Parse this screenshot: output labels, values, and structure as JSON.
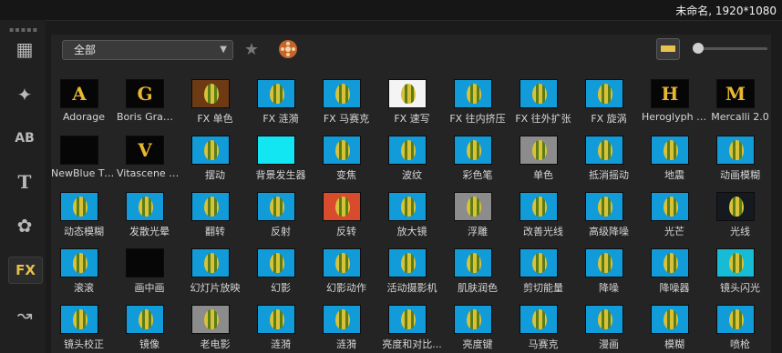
{
  "window": {
    "project_info": "未命名, 1920*1080"
  },
  "sidebar": {
    "icons": [
      "media-icon",
      "instant-project-icon",
      "title-ab-icon",
      "text-t-icon",
      "graphics-icon",
      "fx-icon",
      "path-icon"
    ],
    "fx_label": "FX",
    "ab_label": "AB"
  },
  "toolbar": {
    "category_selected": "全部",
    "dropdown_arrow": "▼"
  },
  "grid": {
    "items": [
      {
        "label": "Adorage",
        "style": "letter",
        "letter": "A"
      },
      {
        "label": "Boris Graffiti ...",
        "style": "letter",
        "letter": "G"
      },
      {
        "label": "FX 单色",
        "style": "brown"
      },
      {
        "label": "FX 涟漪",
        "style": "blue"
      },
      {
        "label": "FX 马赛克",
        "style": "blue"
      },
      {
        "label": "FX 速写",
        "style": "white"
      },
      {
        "label": "FX 往内挤压",
        "style": "blue"
      },
      {
        "label": "FX 往外扩张",
        "style": "blue"
      },
      {
        "label": "FX 旋涡",
        "style": "blue"
      },
      {
        "label": "Heroglyph Ti...",
        "style": "letter",
        "letter": "H"
      },
      {
        "label": "Mercalli 2.0",
        "style": "letter",
        "letter": "M"
      },
      {
        "label": "NewBlue Titl...",
        "style": "black"
      },
      {
        "label": "Vitascene 2.0",
        "style": "letter",
        "letter": "V"
      },
      {
        "label": "摆动",
        "style": "blue"
      },
      {
        "label": "背景发生器",
        "style": "cyan"
      },
      {
        "label": "变焦",
        "style": "blue"
      },
      {
        "label": "波纹",
        "style": "blue"
      },
      {
        "label": "彩色笔",
        "style": "blue"
      },
      {
        "label": "单色",
        "style": "gray"
      },
      {
        "label": "抵消摇动",
        "style": "blue"
      },
      {
        "label": "地震",
        "style": "blue"
      },
      {
        "label": "动画模糊",
        "style": "blue"
      },
      {
        "label": "动态模糊",
        "style": "blue"
      },
      {
        "label": "发散光晕",
        "style": "blue"
      },
      {
        "label": "翻转",
        "style": "blue"
      },
      {
        "label": "反射",
        "style": "blue"
      },
      {
        "label": "反转",
        "style": "red"
      },
      {
        "label": "放大镜",
        "style": "blue"
      },
      {
        "label": "浮雕",
        "style": "gray"
      },
      {
        "label": "改善光线",
        "style": "blue"
      },
      {
        "label": "高级降噪",
        "style": "blue"
      },
      {
        "label": "光芒",
        "style": "blue"
      },
      {
        "label": "光线",
        "style": "dark"
      },
      {
        "label": "滚滚",
        "style": "blue"
      },
      {
        "label": "画中画",
        "style": "black"
      },
      {
        "label": "幻灯片放映",
        "style": "blue"
      },
      {
        "label": "幻影",
        "style": "blue"
      },
      {
        "label": "幻影动作",
        "style": "blue"
      },
      {
        "label": "活动摄影机",
        "style": "blue"
      },
      {
        "label": "肌肤润色",
        "style": "blue"
      },
      {
        "label": "剪切能量",
        "style": "blue"
      },
      {
        "label": "降噪",
        "style": "blue"
      },
      {
        "label": "降噪器",
        "style": "blue"
      },
      {
        "label": "镜头闪光",
        "style": "aqua"
      },
      {
        "label": "镜头校正",
        "style": "blue"
      },
      {
        "label": "镜像",
        "style": "blue"
      },
      {
        "label": "老电影",
        "style": "gray"
      },
      {
        "label": "涟漪",
        "style": "blue"
      },
      {
        "label": "涟漪",
        "style": "blue"
      },
      {
        "label": "亮度和对比...",
        "style": "blue"
      },
      {
        "label": "亮度键",
        "style": "blue"
      },
      {
        "label": "马赛克",
        "style": "blue"
      },
      {
        "label": "漫画",
        "style": "blue"
      },
      {
        "label": "模糊",
        "style": "blue"
      },
      {
        "label": "喷枪",
        "style": "blue"
      }
    ]
  },
  "colors": {
    "accent": "#e9c24d",
    "thumb_blue": "#129bd9"
  }
}
